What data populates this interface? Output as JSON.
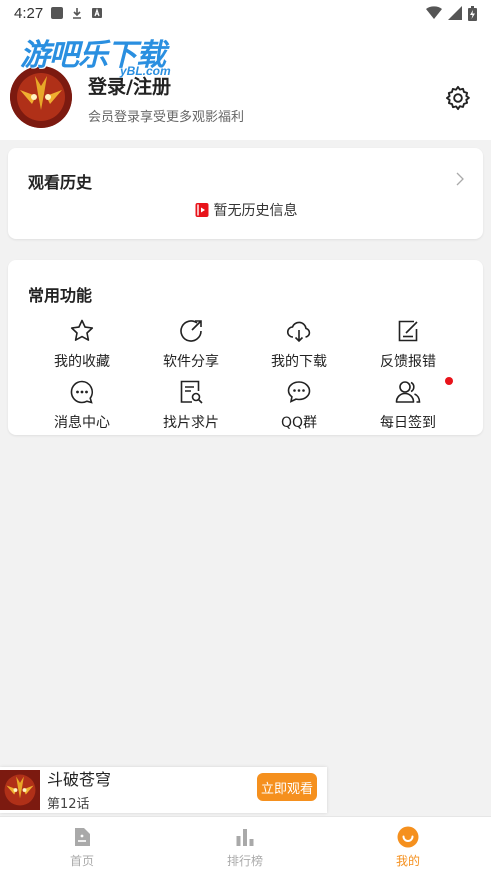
{
  "status_bar": {
    "time": "4:27"
  },
  "brand": {
    "name": "游吧乐下载",
    "domain": "yBL.com"
  },
  "user": {
    "title": "登录/注册",
    "subtitle": "会员登录享受更多观影福利"
  },
  "history": {
    "title": "观看历史",
    "empty_text": "暂无历史信息"
  },
  "functions": {
    "title": "常用功能",
    "items": [
      {
        "label": "我的收藏",
        "icon": "star-icon"
      },
      {
        "label": "软件分享",
        "icon": "share-icon"
      },
      {
        "label": "我的下载",
        "icon": "cloud-download-icon"
      },
      {
        "label": "反馈报错",
        "icon": "feedback-edit-icon"
      },
      {
        "label": "消息中心",
        "icon": "message-icon"
      },
      {
        "label": "找片求片",
        "icon": "search-document-icon"
      },
      {
        "label": "QQ群",
        "icon": "chat-bubble-icon"
      },
      {
        "label": "每日签到",
        "icon": "users-icon"
      }
    ]
  },
  "mini_player": {
    "title": "斗破苍穹",
    "episode": "第12话",
    "button": "立即观看"
  },
  "tabs": [
    {
      "label": "首页",
      "icon": "home-icon",
      "active": false
    },
    {
      "label": "排行榜",
      "icon": "ranking-icon",
      "active": false
    },
    {
      "label": "我的",
      "icon": "smile-icon",
      "active": true
    }
  ],
  "colors": {
    "accent": "#f5901e",
    "badge": "#e8131a",
    "brand": "#2a8fe0"
  }
}
